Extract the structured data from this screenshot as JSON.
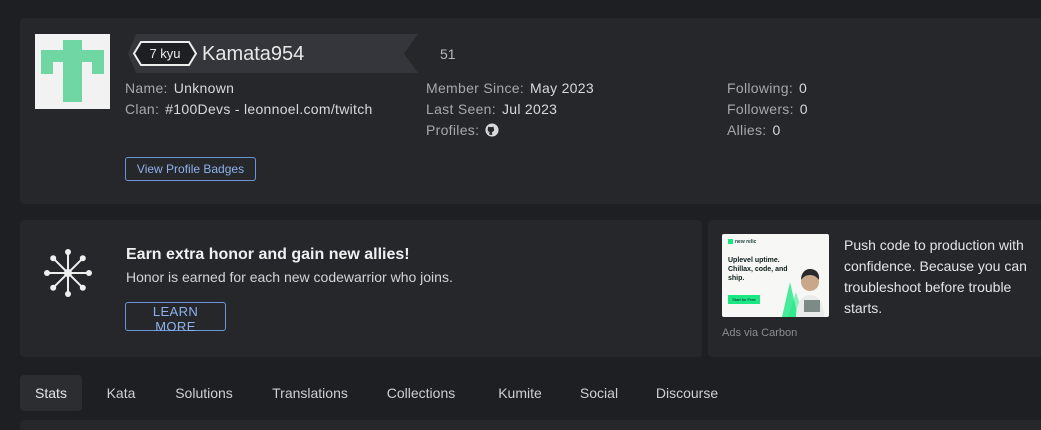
{
  "profile": {
    "rank": "7 kyu",
    "username": "Kamata954",
    "honor": "51",
    "col1": [
      {
        "label": "Name:",
        "value": "Unknown"
      },
      {
        "label": "Clan:",
        "value": "#100Devs - leonnoel.com/twitch"
      }
    ],
    "col2": [
      {
        "label": "Member Since:",
        "value": "May 2023"
      },
      {
        "label": "Last Seen:",
        "value": "Jul 2023"
      },
      {
        "label": "Profiles:",
        "value": ""
      }
    ],
    "col3": [
      {
        "label": "Following:",
        "value": "0"
      },
      {
        "label": "Followers:",
        "value": "0"
      },
      {
        "label": "Allies:",
        "value": "0"
      }
    ],
    "profiles_icon": "github-icon",
    "view_badges_label": "View Profile Badges"
  },
  "honor_promo": {
    "icon": "network-hub-icon",
    "title": "Earn extra honor and gain new allies!",
    "description": "Honor is earned for each new codewarrior who joins.",
    "button_label": "LEARN MORE"
  },
  "ad": {
    "brand": "new relic",
    "headline": "Uplevel uptime. Chillax, code, and ship.",
    "cta": "Start for Free",
    "text": "Push code to production with confidence. Because you can troubleshoot before trouble starts.",
    "via": "Ads via Carbon"
  },
  "tabs": [
    {
      "label": "Stats",
      "active": true
    },
    {
      "label": "Kata",
      "active": false
    },
    {
      "label": "Solutions",
      "active": false
    },
    {
      "label": "Translations",
      "active": false
    },
    {
      "label": "Collections",
      "active": false
    },
    {
      "label": "Kumite",
      "active": false
    },
    {
      "label": "Social",
      "active": false
    },
    {
      "label": "Discourse",
      "active": false
    }
  ],
  "colors": {
    "background": "#1e1f23",
    "card": "#26272b",
    "rank_banner": "#35363b",
    "avatar_accent": "#6fd6a4",
    "link_accent": "#6d94d9"
  }
}
